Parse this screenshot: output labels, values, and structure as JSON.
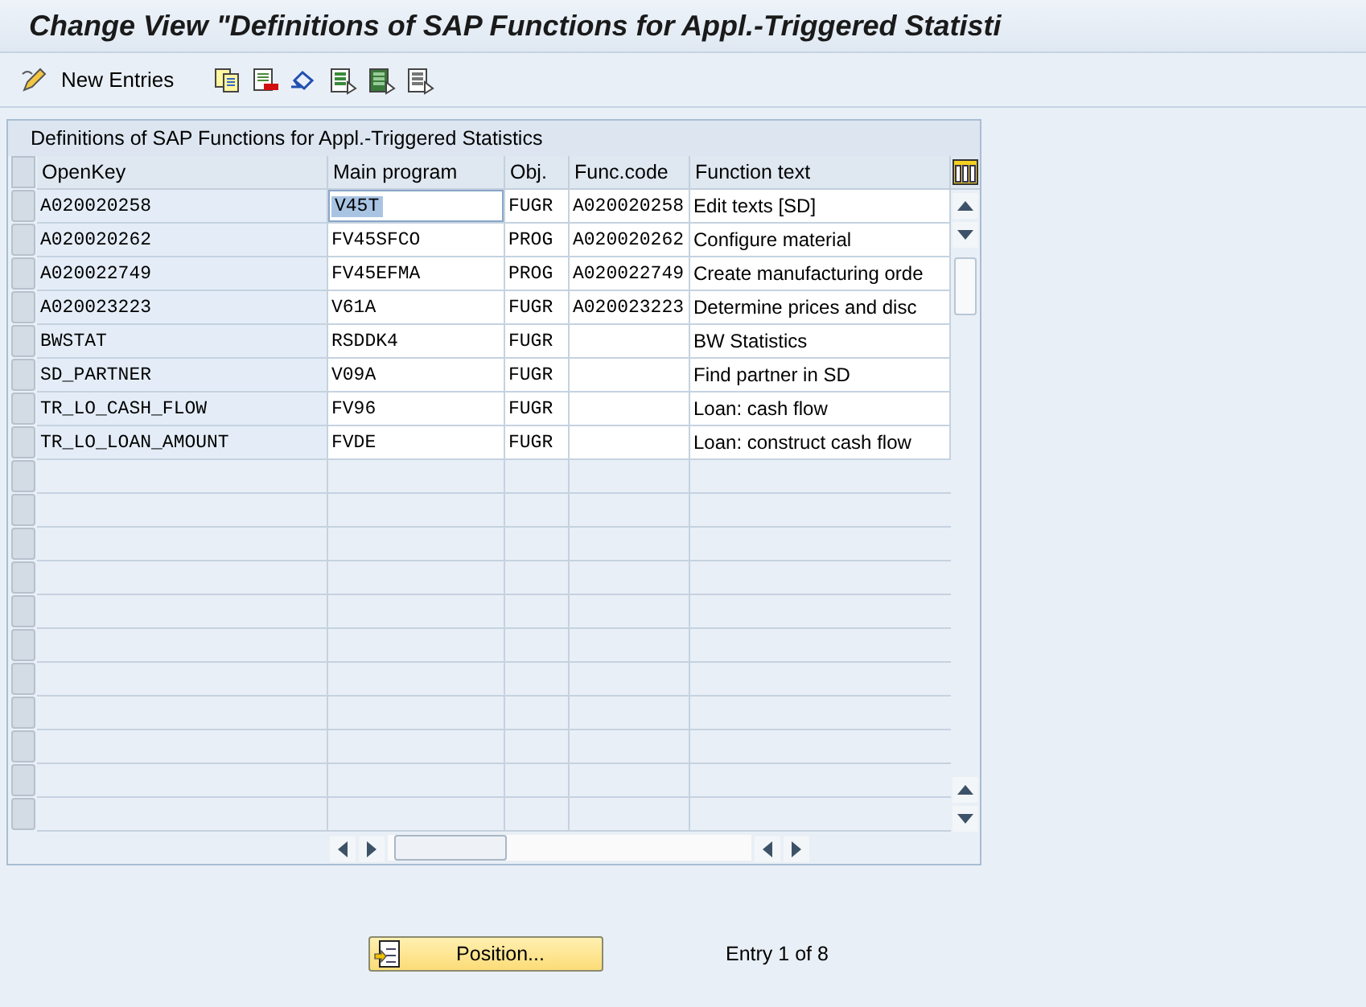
{
  "window": {
    "title": "Change View \"Definitions of SAP Functions for Appl.-Triggered Statisti"
  },
  "toolbar": {
    "new_entries": "New Entries"
  },
  "table": {
    "title": "Definitions of SAP Functions for Appl.-Triggered Statistics",
    "columns": [
      "OpenKey",
      "Main program",
      "Obj.",
      "Func.code",
      "Function text"
    ],
    "rows": [
      {
        "cells": [
          "A020020258",
          "V45T",
          "FUGR",
          "A020020258",
          "Edit texts [SD]"
        ],
        "main_program_selected": true
      },
      {
        "cells": [
          "A020020262",
          "FV45SFCO",
          "PROG",
          "A020020262",
          "Configure material"
        ],
        "main_program_selected": false
      },
      {
        "cells": [
          "A020022749",
          "FV45EFMA",
          "PROG",
          "A020022749",
          "Create manufacturing orde"
        ],
        "main_program_selected": false
      },
      {
        "cells": [
          "A020023223",
          "V61A",
          "FUGR",
          "A020023223",
          "Determine prices and disc"
        ],
        "main_program_selected": false
      },
      {
        "cells": [
          "BWSTAT",
          "RSDDK4",
          "FUGR",
          "",
          "BW Statistics"
        ],
        "main_program_selected": false
      },
      {
        "cells": [
          "SD_PARTNER",
          "V09A",
          "FUGR",
          "",
          "Find partner in SD"
        ],
        "main_program_selected": false
      },
      {
        "cells": [
          "TR_LO_CASH_FLOW",
          "FV96",
          "FUGR",
          "",
          "Loan: cash flow"
        ],
        "main_program_selected": false
      },
      {
        "cells": [
          "TR_LO_LOAN_AMOUNT",
          "FVDE",
          "FUGR",
          "",
          "Loan: construct cash flow"
        ],
        "main_program_selected": false
      }
    ]
  },
  "footer": {
    "position_button": "Position...",
    "entry_info": "Entry 1 of 8"
  }
}
